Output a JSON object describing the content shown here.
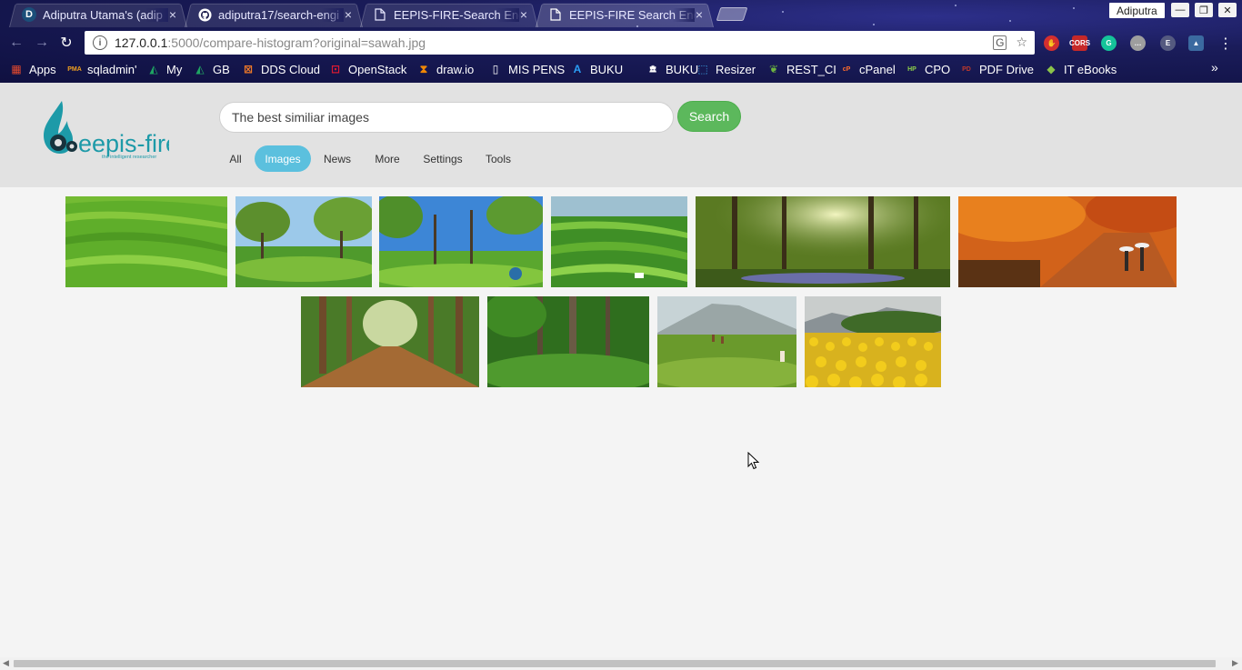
{
  "browser": {
    "tabs": [
      {
        "title": "Adiputra Utama's (adip",
        "favicon": "D",
        "active": false
      },
      {
        "title": "adiputra17/search-engi",
        "favicon": "github-icon",
        "active": false
      },
      {
        "title": "EEPIS-FIRE-Search Engi",
        "favicon": "page-icon",
        "active": false
      },
      {
        "title": "EEPIS-FIRE Search Engi",
        "favicon": "page-icon",
        "active": true
      }
    ],
    "close_glyph": "×",
    "profile_name": "Adiputra",
    "url_host": "127.0.0.1",
    "url_path": ":5000/compare-histogram?original=sawah.jpg",
    "bookmarks": [
      {
        "label": "Apps",
        "icon": "apps-grid-icon",
        "color": "#e0482e"
      },
      {
        "label": "sqladmin'",
        "icon": "pma-icon",
        "color": "#f0a020"
      },
      {
        "label": "My",
        "icon": "drive-icon",
        "color": "#1fa463"
      },
      {
        "label": "GB",
        "icon": "drive-icon",
        "color": "#1fa463"
      },
      {
        "label": "DDS Cloud",
        "icon": "dds-icon",
        "color": "#f07a28"
      },
      {
        "label": "OpenStack",
        "icon": "openstack-icon",
        "color": "#da1a32"
      },
      {
        "label": "draw.io",
        "icon": "drawio-icon",
        "color": "#f08705"
      },
      {
        "label": "MIS PENS",
        "icon": "page-icon",
        "color": "#ffffff"
      },
      {
        "label": "BUKU",
        "icon": "book-a-icon",
        "color": "#2a9df4"
      },
      {
        "label": "BUKU",
        "icon": "library-icon",
        "color": "#ffffff"
      },
      {
        "label": "Resizer",
        "icon": "resizer-icon",
        "color": "#3aa0e0"
      },
      {
        "label": "REST_CI",
        "icon": "leaf-icon",
        "color": "#6cb33f"
      },
      {
        "label": "cPanel",
        "icon": "cpanel-icon",
        "color": "#ff6c2c"
      },
      {
        "label": "CPO",
        "icon": "hp-icon",
        "color": "#8ed04a"
      },
      {
        "label": "PDF Drive",
        "icon": "pdfdrive-icon",
        "color": "#c0392b"
      },
      {
        "label": "IT eBooks",
        "icon": "itebooks-icon",
        "color": "#8bc34a"
      }
    ]
  },
  "page": {
    "search_value": "The best similiar images",
    "search_button": "Search",
    "nav_tabs": [
      "All",
      "Images",
      "News",
      "More",
      "Settings",
      "Tools"
    ],
    "active_tab": "Images",
    "logo_text": "eepis-fire",
    "logo_tagline": "the intelligent researcher",
    "results": [
      {
        "name": "terraced-rice-field"
      },
      {
        "name": "tea-garden-trees"
      },
      {
        "name": "tea-garden-blue-sky"
      },
      {
        "name": "green-rice-terraces"
      },
      {
        "name": "sunlit-forest"
      },
      {
        "name": "autumn-path-umbrellas"
      },
      {
        "name": "teak-forest-road"
      },
      {
        "name": "dense-green-forest"
      },
      {
        "name": "tea-pickers-mountain"
      },
      {
        "name": "sunflower-field"
      }
    ]
  },
  "colors": {
    "header_bg": "#e2e2e2",
    "page_bg": "#f4f4f4",
    "search_button": "#5cb85c",
    "active_tab": "#5bc0de",
    "logo": "#1d9aa8"
  }
}
